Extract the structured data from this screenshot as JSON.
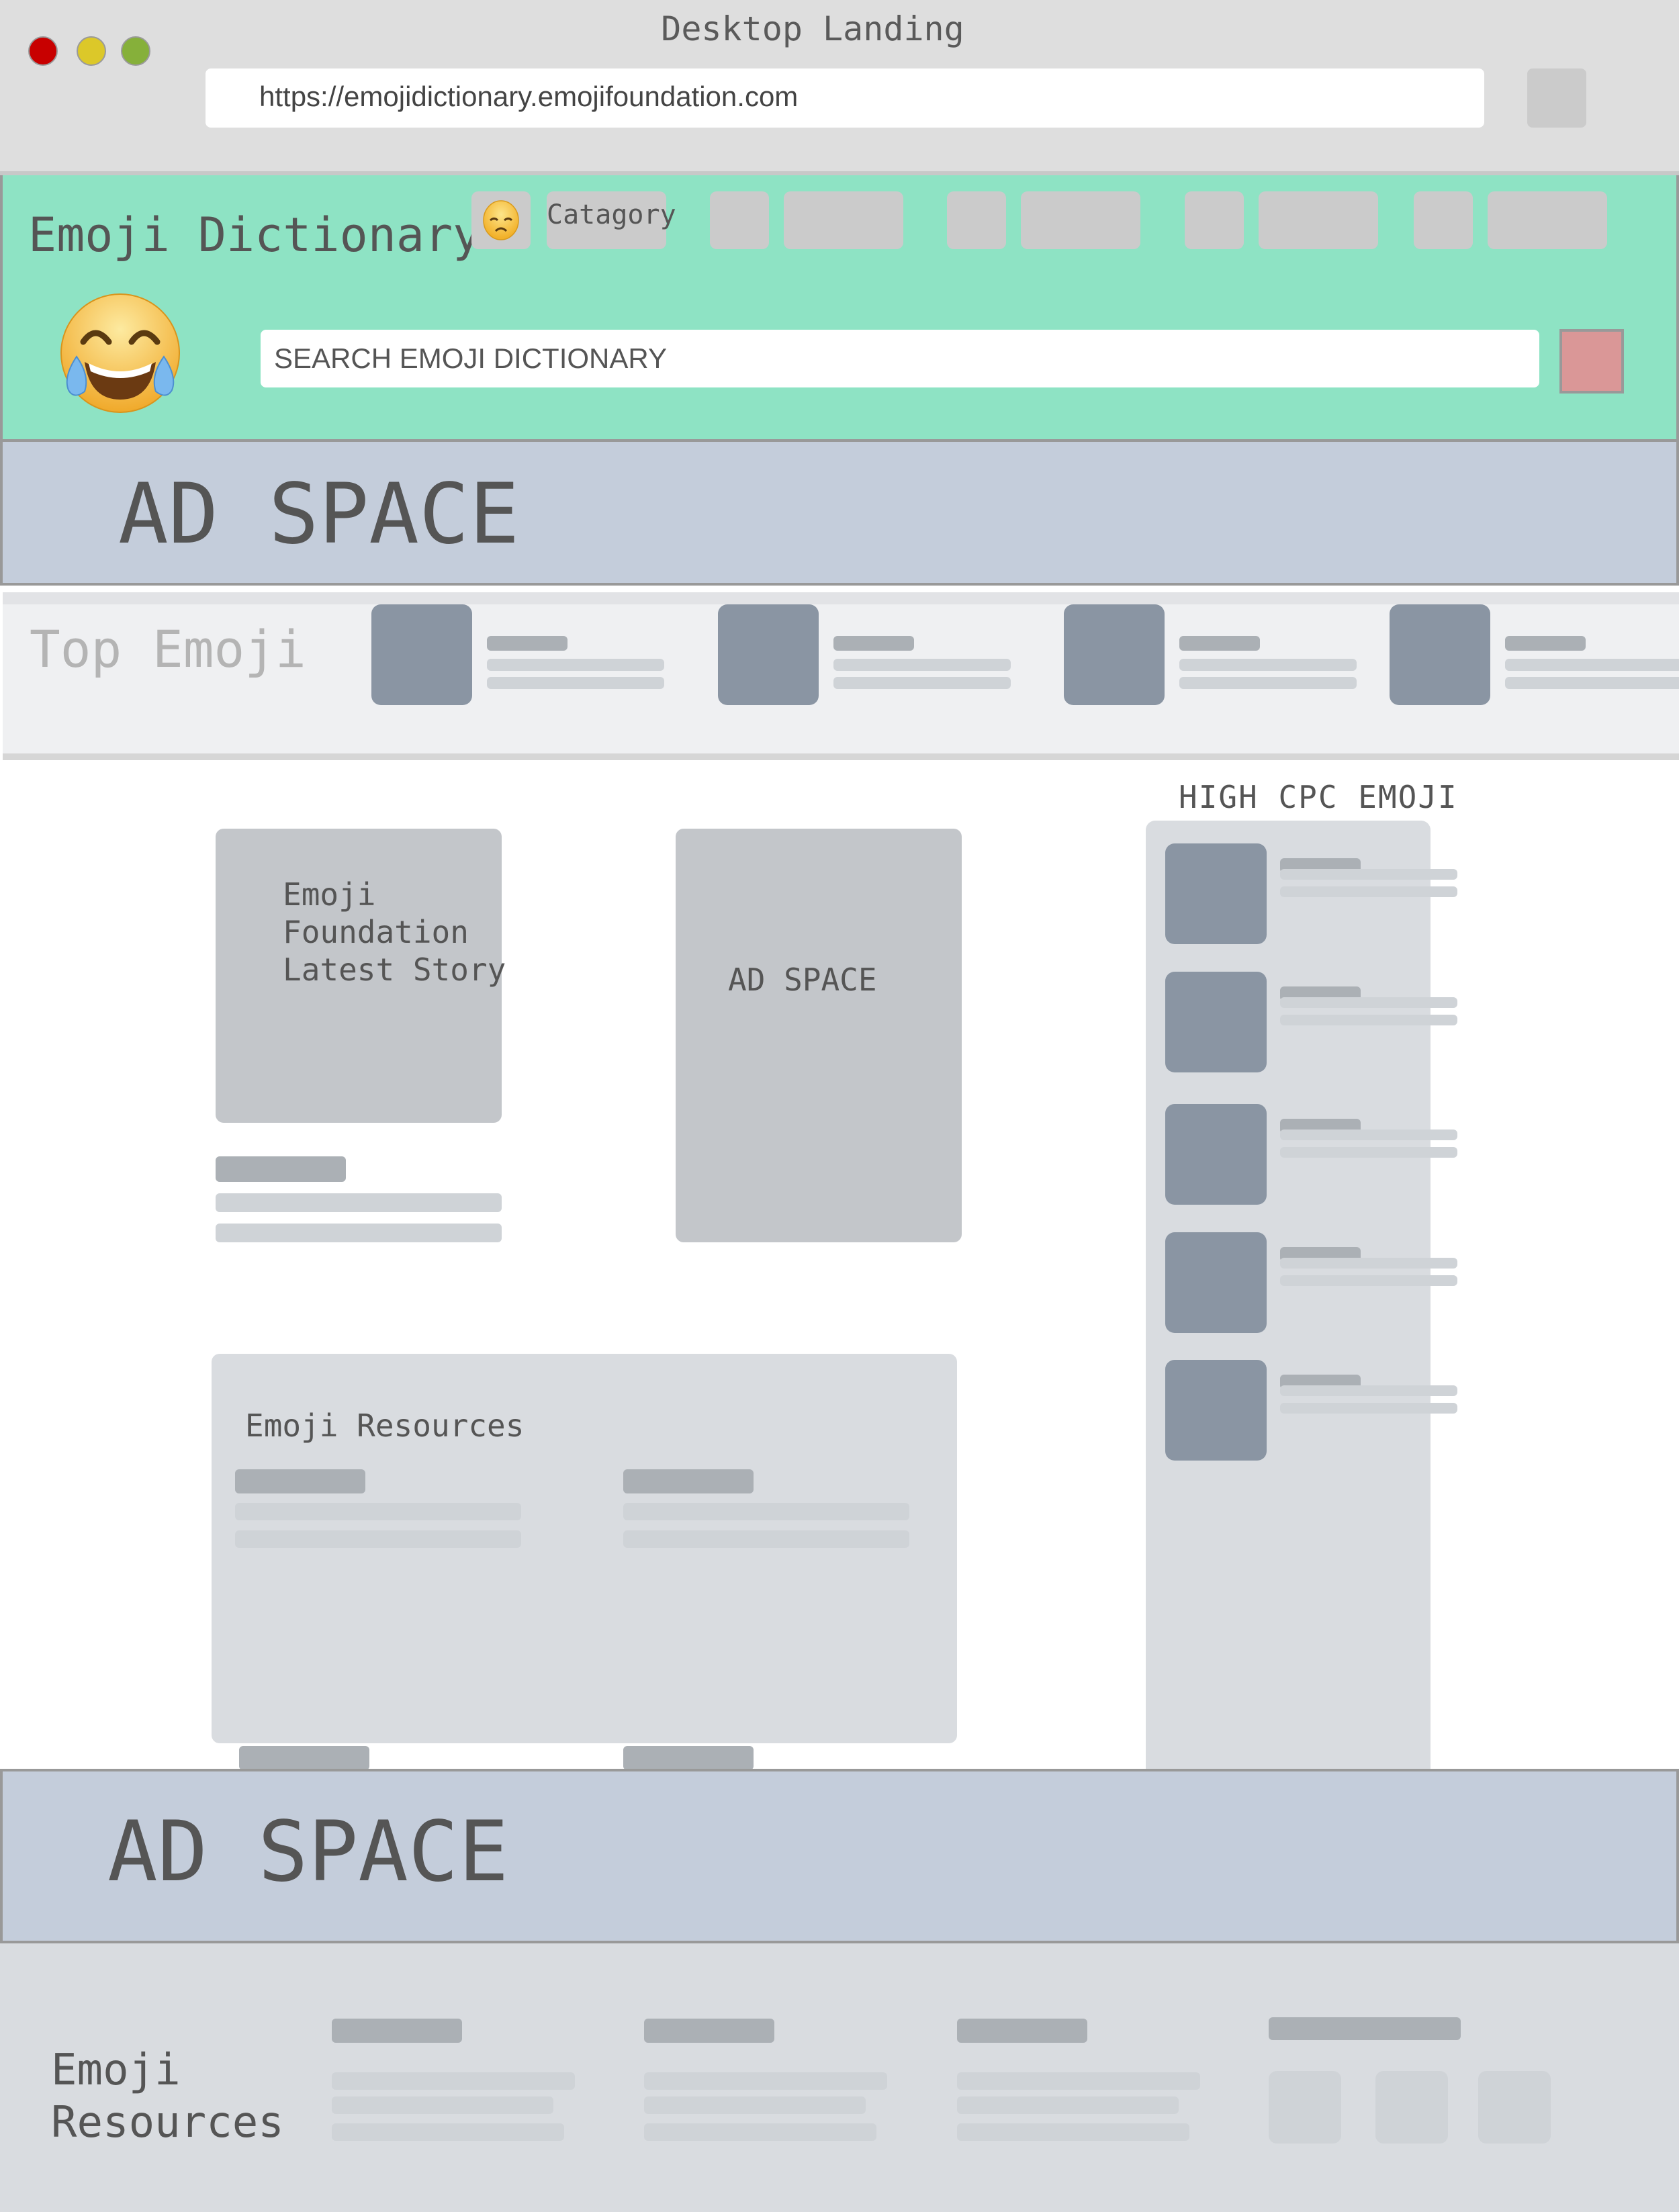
{
  "window": {
    "title": "Desktop Landing",
    "url": "https://emojidictionary.emojifoundation.com",
    "controls": [
      "close",
      "minimize",
      "maximize"
    ],
    "colors": {
      "close": "#c80000",
      "minimize": "#dcc829",
      "maximize": "#86b03a"
    }
  },
  "header": {
    "site_title": "Emoji Dictionary",
    "nav": [
      {
        "icon": "disappointed-face-icon",
        "label": "Catagory"
      },
      {
        "icon": "",
        "label": ""
      },
      {
        "icon": "",
        "label": ""
      },
      {
        "icon": "",
        "label": ""
      }
    ],
    "mascot": "face-with-tears-of-joy-emoji",
    "search": {
      "placeholder": "SEARCH EMOJI DICTIONARY",
      "value": ""
    },
    "colors": {
      "background": "#8ee3c4",
      "search_button": "#da9797"
    }
  },
  "ad_top": {
    "label": "AD SPACE"
  },
  "top_emoji": {
    "title": "Top Emoji",
    "items": 4
  },
  "latest_story": {
    "title": "Emoji\nFoundation\nLatest Story"
  },
  "ad_tall": {
    "label": "AD SPACE"
  },
  "resources": {
    "title": "Emoji Resources",
    "items": 4
  },
  "high_cpc": {
    "title": "HIGH CPC EMOJI",
    "items": 5
  },
  "ad_bottom": {
    "label": "AD SPACE"
  },
  "footer": {
    "title": "Emoji\nResources",
    "columns": 3,
    "social_icons": 3
  }
}
